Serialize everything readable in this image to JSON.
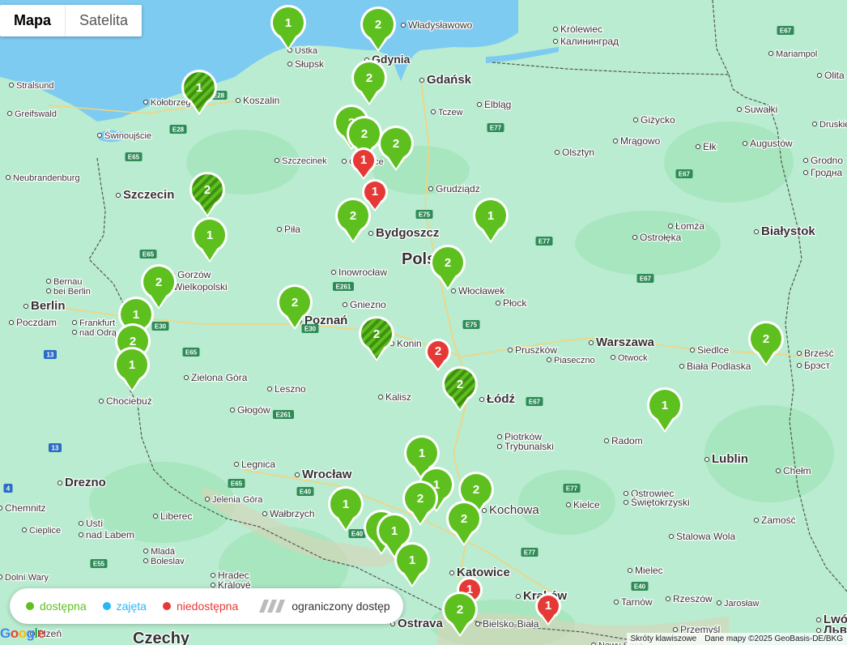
{
  "map_type_control": {
    "map_label": "Mapa",
    "satellite_label": "Satelita"
  },
  "colors": {
    "available": "#5ec01f",
    "occupied": "#29b6f6",
    "unavailable": "#e53935",
    "land": "#b9ecd0",
    "water": "#7ecbf1",
    "forest": "#9fe0b3"
  },
  "legend": {
    "available": "dostępna",
    "occupied": "zajęta",
    "unavailable": "niedostępna",
    "restricted": "ograniczony dostęp"
  },
  "attribution": {
    "shortcuts": "Skróty klawiszowe",
    "data": "Dane mapy ©2025 GeoBasis-DE/BKG",
    "google": "Google"
  },
  "cities": [
    {
      "name": "Ustka",
      "size": 11
    },
    {
      "name": "Słupsk",
      "size": 12
    },
    {
      "name": "Władysławowo",
      "size": 12
    },
    {
      "name": "Gdynia",
      "size": 14
    },
    {
      "name": "Gdańsk",
      "size": 15
    },
    {
      "name": "Królewiec",
      "size": 12
    },
    {
      "name": "Калининград",
      "size": 12
    },
    {
      "name": "Mariampol",
      "size": 11
    },
    {
      "name": "Olita",
      "size": 12
    },
    {
      "name": "Druskie",
      "size": 11
    },
    {
      "name": "Stralsund",
      "size": 11
    },
    {
      "name": "Greifswald",
      "size": 11
    },
    {
      "name": "Kołobrzeg",
      "size": 11
    },
    {
      "name": "Koszalin",
      "size": 12
    },
    {
      "name": "Tczew",
      "size": 11
    },
    {
      "name": "Elbląg",
      "size": 12
    },
    {
      "name": "Giżycko",
      "size": 12
    },
    {
      "name": "Suwałki",
      "size": 12
    },
    {
      "name": "Świnoujście",
      "size": 11
    },
    {
      "name": "Szczecinek",
      "size": 11
    },
    {
      "name": "Chojnice",
      "size": 11
    },
    {
      "name": "Olsztyn",
      "size": 12
    },
    {
      "name": "Mrągowo",
      "size": 12
    },
    {
      "name": "Ełk",
      "size": 12
    },
    {
      "name": "Augustów",
      "size": 12
    },
    {
      "name": "Grodno",
      "size": 12
    },
    {
      "name": "Гродна",
      "size": 12
    },
    {
      "name": "Neubrandenburg",
      "size": 11
    },
    {
      "name": "Szczecin",
      "size": 15
    },
    {
      "name": "Grudziądz",
      "size": 12
    },
    {
      "name": "Piła",
      "size": 12
    },
    {
      "name": "Bydgoszcz",
      "size": 15
    },
    {
      "name": "Łomża",
      "size": 12
    },
    {
      "name": "Białystok",
      "size": 15
    },
    {
      "name": "Ostrołęka",
      "size": 12
    },
    {
      "name": "Gorzów",
      "size": 12
    },
    {
      "name": "Wielkopolski",
      "size": 12
    },
    {
      "name": "Polska",
      "size": 20
    },
    {
      "name": "Inowrocław",
      "size": 12
    },
    {
      "name": "Bernau",
      "size": 11
    },
    {
      "name": "bei Berlin",
      "size": 11
    },
    {
      "name": "Berlin",
      "size": 15
    },
    {
      "name": "Poczdam",
      "size": 12
    },
    {
      "name": "Włocławek",
      "size": 12
    },
    {
      "name": "Gniezno",
      "size": 12
    },
    {
      "name": "Płock",
      "size": 12
    },
    {
      "name": "Poznań",
      "size": 15
    },
    {
      "name": "Frankfurt",
      "size": 11
    },
    {
      "name": "nad Odrą",
      "size": 11
    },
    {
      "name": "Konin",
      "size": 12
    },
    {
      "name": "Warszawa",
      "size": 15
    },
    {
      "name": "Siedlce",
      "size": 12
    },
    {
      "name": "Brześć",
      "size": 12
    },
    {
      "name": "Брэст",
      "size": 12
    },
    {
      "name": "Pruszków",
      "size": 12
    },
    {
      "name": "Piaseczno",
      "size": 11
    },
    {
      "name": "Otwock",
      "size": 11
    },
    {
      "name": "Biała Podlaska",
      "size": 12
    },
    {
      "name": "Zielona Góra",
      "size": 12
    },
    {
      "name": "Leszno",
      "size": 12
    },
    {
      "name": "Kalisz",
      "size": 12
    },
    {
      "name": "Łódź",
      "size": 15
    },
    {
      "name": "Chociebuż",
      "size": 12
    },
    {
      "name": "Głogów",
      "size": 12
    },
    {
      "name": "Piotrków",
      "size": 12
    },
    {
      "name": "Trybunalski",
      "size": 12
    },
    {
      "name": "Radom",
      "size": 12
    },
    {
      "name": "Lublin",
      "size": 15
    },
    {
      "name": "Legnica",
      "size": 12
    },
    {
      "name": "Wrocław",
      "size": 15
    },
    {
      "name": "Chełm",
      "size": 12
    },
    {
      "name": "Drezno",
      "size": 15
    },
    {
      "name": "Jelenia Góra",
      "size": 11
    },
    {
      "name": "Wałbrzych",
      "size": 12
    },
    {
      "name": "Ostrowiec",
      "size": 12
    },
    {
      "name": "Świętokrzyski",
      "size": 12
    },
    {
      "name": "Kielce",
      "size": 12
    },
    {
      "name": "Chemnitz",
      "size": 12
    },
    {
      "name": "Liberec",
      "size": 12
    },
    {
      "name": "Zamość",
      "size": 12
    },
    {
      "name": "Ústí",
      "size": 12
    },
    {
      "name": "nad Labem",
      "size": 12
    },
    {
      "name": "Cieplice",
      "size": 11
    },
    {
      "name": "Mladá",
      "size": 11
    },
    {
      "name": "Boleslav",
      "size": 11
    },
    {
      "name": "Stalowa Wola",
      "size": 12
    },
    {
      "name": "Katowice",
      "size": 15
    },
    {
      "name": "Hradec",
      "size": 12
    },
    {
      "name": "Králové",
      "size": 12
    },
    {
      "name": "Mielec",
      "size": 12
    },
    {
      "name": "Kraków",
      "size": 15
    },
    {
      "name": "Tarnów",
      "size": 12
    },
    {
      "name": "Rzeszów",
      "size": 12
    },
    {
      "name": "Jarosław",
      "size": 11
    },
    {
      "name": "Lwów",
      "size": 15
    },
    {
      "name": "Львів",
      "size": 15
    },
    {
      "name": "Usti nad Labem",
      "size": 11
    },
    {
      "name": "Ostrava",
      "size": 15
    },
    {
      "name": "Bielsko-Biała",
      "size": 12
    },
    {
      "name": "Przemyśl",
      "size": 12
    },
    {
      "name": "Nowy Sącz",
      "size": 11
    },
    {
      "name": "Czechy",
      "size": 20
    },
    {
      "name": "Plzeň",
      "size": 12
    },
    {
      "name": "Kochowa",
      "size": 15
    },
    {
      "name": "Dolní Wary",
      "size": 11
    }
  ],
  "roads": [
    "E28",
    "E28",
    "E65",
    "E65",
    "E65",
    "E67",
    "E67",
    "E67",
    "E67",
    "E75",
    "E77",
    "E77",
    "E77",
    "E77",
    "E30",
    "E30",
    "E261",
    "E261",
    "E65",
    "E40",
    "E40",
    "E40",
    "E55",
    "E75",
    "13",
    "13",
    "4"
  ],
  "markers": [
    {
      "status": "available",
      "count": 1,
      "restricted": false
    },
    {
      "status": "available",
      "count": 2,
      "restricted": false
    },
    {
      "status": "available",
      "count": 1,
      "restricted": true
    },
    {
      "status": "available",
      "count": 2,
      "restricted": false
    },
    {
      "status": "available",
      "count": 2,
      "restricted": false
    },
    {
      "status": "available",
      "count": 2,
      "restricted": false
    },
    {
      "status": "available",
      "count": 2,
      "restricted": false
    },
    {
      "status": "unavailable",
      "count": 1,
      "restricted": false
    },
    {
      "status": "unavailable",
      "count": 1,
      "restricted": false
    },
    {
      "status": "available",
      "count": 2,
      "restricted": true
    },
    {
      "status": "available",
      "count": 2,
      "restricted": false
    },
    {
      "status": "available",
      "count": 1,
      "restricted": false
    },
    {
      "status": "available",
      "count": 1,
      "restricted": false
    },
    {
      "status": "available",
      "count": 2,
      "restricted": false
    },
    {
      "status": "available",
      "count": 2,
      "restricted": false
    },
    {
      "status": "available",
      "count": 1,
      "restricted": false
    },
    {
      "status": "available",
      "count": 2,
      "restricted": false
    },
    {
      "status": "available",
      "count": 2,
      "restricted": false
    },
    {
      "status": "available",
      "count": 1,
      "restricted": false
    },
    {
      "status": "available",
      "count": 2,
      "restricted": true
    },
    {
      "status": "unavailable",
      "count": 2,
      "restricted": false
    },
    {
      "status": "available",
      "count": 2,
      "restricted": true
    },
    {
      "status": "available",
      "count": 1,
      "restricted": false
    },
    {
      "status": "available",
      "count": 2,
      "restricted": false
    },
    {
      "status": "available",
      "count": 1,
      "restricted": false
    },
    {
      "status": "available",
      "count": 1,
      "restricted": false
    },
    {
      "status": "available",
      "count": 1,
      "restricted": false
    },
    {
      "status": "available",
      "count": 2,
      "restricted": false
    },
    {
      "status": "available",
      "count": 2,
      "restricted": false
    },
    {
      "status": "available",
      "count": 2,
      "restricted": false
    },
    {
      "status": "available",
      "count": 1,
      "restricted": false
    },
    {
      "status": "available",
      "count": 1,
      "restricted": false
    },
    {
      "status": "available",
      "count": 1,
      "restricted": false
    },
    {
      "status": "unavailable",
      "count": 1,
      "restricted": false
    },
    {
      "status": "unavailable",
      "count": 1,
      "restricted": false
    },
    {
      "status": "available",
      "count": 2,
      "restricted": false
    }
  ]
}
